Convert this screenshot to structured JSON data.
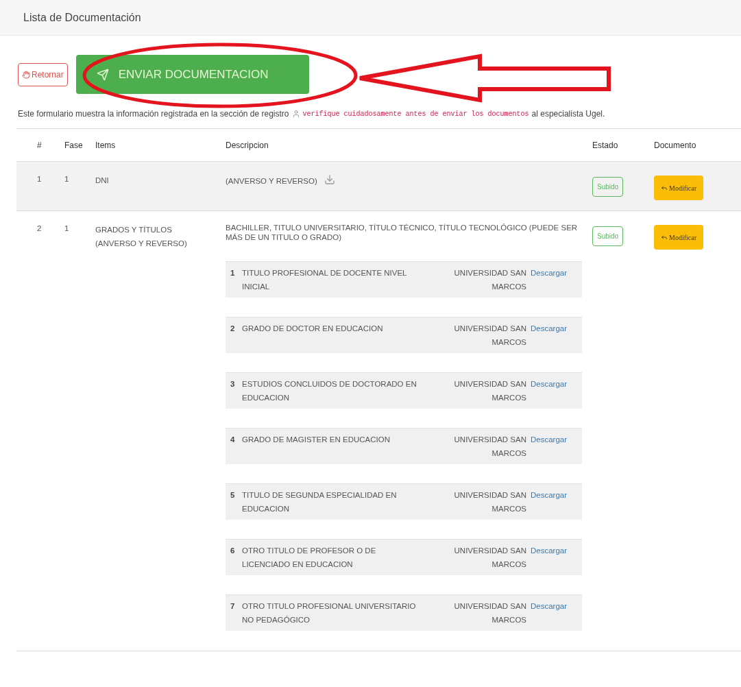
{
  "page_title": "Lista de Documentación",
  "back_button": {
    "label": "Retornar"
  },
  "send_button": {
    "label": "ENVIAR DOCUMENTACION"
  },
  "notice": {
    "before": "Este formulario muestra la información registrada en la sección de registro",
    "highlight": "verifique cuidadosamente antes de enviar los documentos",
    "after": "al especialista Ugel."
  },
  "table": {
    "columns": [
      "#",
      "Fase",
      "Items",
      "Descripcion",
      "Estado",
      "Documento"
    ],
    "rows": [
      {
        "number": "1",
        "phase": "1",
        "item": "DNI",
        "description": "(ANVERSO Y REVERSO)",
        "download_icon": true,
        "status": "Subido",
        "action": "Modificar",
        "entries": []
      },
      {
        "number": "2",
        "phase": "1",
        "item": "GRADOS Y TÍTULOS (ANVERSO Y REVERSO)",
        "description": "BACHILLER, TITULO UNIVERSITARIO, TÍTULO TÉCNICO, TÍTULO TECNOLÓGICO (PUEDE SER MÁS DE UN TITULO O GRADO)",
        "download_icon": false,
        "status": "Subido",
        "action": "Modificar",
        "entries": [
          {
            "number": "1",
            "title": "TITULO PROFESIONAL DE DOCENTE NIVEL INICIAL",
            "institution": "UNIVERSIDAD SAN MARCOS",
            "link": "Descargar"
          },
          {
            "number": "2",
            "title": "GRADO DE DOCTOR EN EDUCACION",
            "institution": "UNIVERSIDAD SAN MARCOS",
            "link": "Descargar"
          },
          {
            "number": "3",
            "title": "ESTUDIOS CONCLUIDOS DE DOCTORADO EN EDUCACION",
            "institution": "UNIVERSIDAD SAN MARCOS",
            "link": "Descargar"
          },
          {
            "number": "4",
            "title": "GRADO DE MAGISTER EN EDUCACION",
            "institution": "UNIVERSIDAD SAN MARCOS",
            "link": "Descargar"
          },
          {
            "number": "5",
            "title": "TITULO DE SEGUNDA ESPECIALIDAD EN EDUCACION",
            "institution": "UNIVERSIDAD SAN MARCOS",
            "link": "Descargar"
          },
          {
            "number": "6",
            "title": "OTRO TITULO DE PROFESOR O DE LICENCIADO EN EDUCACION",
            "institution": "UNIVERSIDAD SAN MARCOS",
            "link": "Descargar"
          },
          {
            "number": "7",
            "title": "OTRO TITULO PROFESIONAL UNIVERSITARIO NO PEDAGÓGICO",
            "institution": "UNIVERSIDAD SAN MARCOS",
            "link": "Descargar"
          }
        ]
      }
    ]
  }
}
